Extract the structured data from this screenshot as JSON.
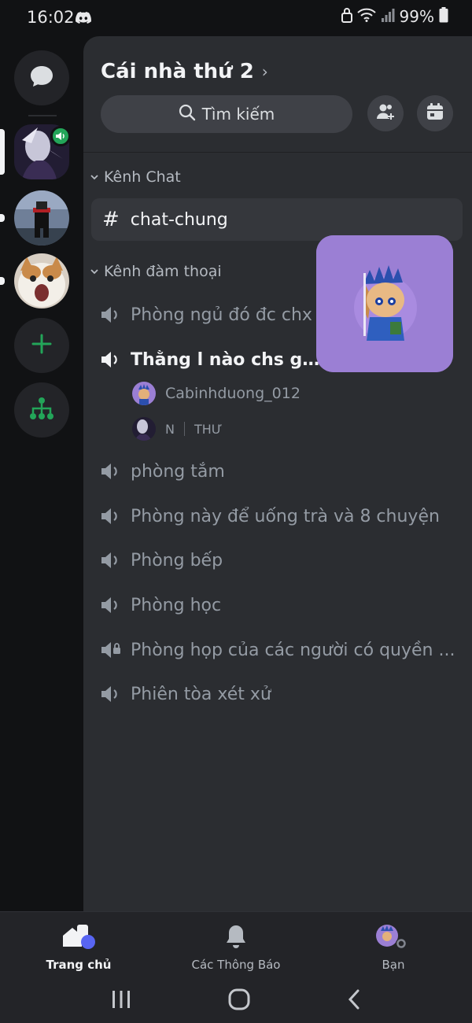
{
  "status_bar": {
    "time": "16:02",
    "battery": "99%",
    "icons": [
      "discord-icon",
      "lock-icon",
      "wifi-icon",
      "signal-icon",
      "battery-icon"
    ]
  },
  "rail": {
    "items": [
      {
        "name": "direct-messages",
        "icon": "chat-bubble-icon"
      },
      {
        "name": "server-1",
        "active": true,
        "voice": true
      },
      {
        "name": "server-2",
        "unread": true
      },
      {
        "name": "server-3",
        "unread": true
      },
      {
        "name": "add-server",
        "icon": "plus-icon"
      },
      {
        "name": "discover",
        "icon": "hub-icon"
      }
    ]
  },
  "header": {
    "server_name": "Cái nhà thứ 2",
    "search_label": "Tìm kiếm",
    "invite_icon": "add-member-icon",
    "events_icon": "calendar-icon"
  },
  "categories": {
    "text": "Kênh Chat",
    "voice": "Kênh đàm thoại"
  },
  "text_channels": [
    {
      "name": "chat-chung",
      "selected": true
    }
  ],
  "voice_channels": [
    {
      "name": "Phòng ngủ đó đc chx",
      "active": false
    },
    {
      "name": "Thằng l nào chs game",
      "active": true
    },
    {
      "name": "phòng tắm",
      "active": false
    },
    {
      "name": "Phòng này để uống trà và 8 chuyện",
      "active": false
    },
    {
      "name": "Phòng bếp",
      "active": false
    },
    {
      "name": "Phòng học",
      "active": false
    },
    {
      "name": "Phòng họp của các người có quyền ...",
      "active": false,
      "locked": true
    },
    {
      "name": "Phiên tòa xét xử",
      "active": false
    }
  ],
  "voice_members": [
    {
      "name": "Cabinhduong_012"
    },
    {
      "name": "N",
      "tag": "THƯ"
    }
  ],
  "bottom_nav": {
    "tabs": [
      {
        "label": "Trang chủ",
        "icon": "home-icon",
        "active": true
      },
      {
        "label": "Các Thông Báo",
        "icon": "bell-icon",
        "active": false
      },
      {
        "label": "Bạn",
        "icon": "profile-avatar",
        "active": false
      }
    ]
  },
  "system_nav": [
    "recent-apps-icon",
    "home-circle-icon",
    "back-icon"
  ],
  "colors": {
    "background": "#111214",
    "panel": "#2b2d31",
    "voice_green": "#23a559",
    "accent_blurple": "#5865f2",
    "tile_purple": "#9b7fd4"
  }
}
